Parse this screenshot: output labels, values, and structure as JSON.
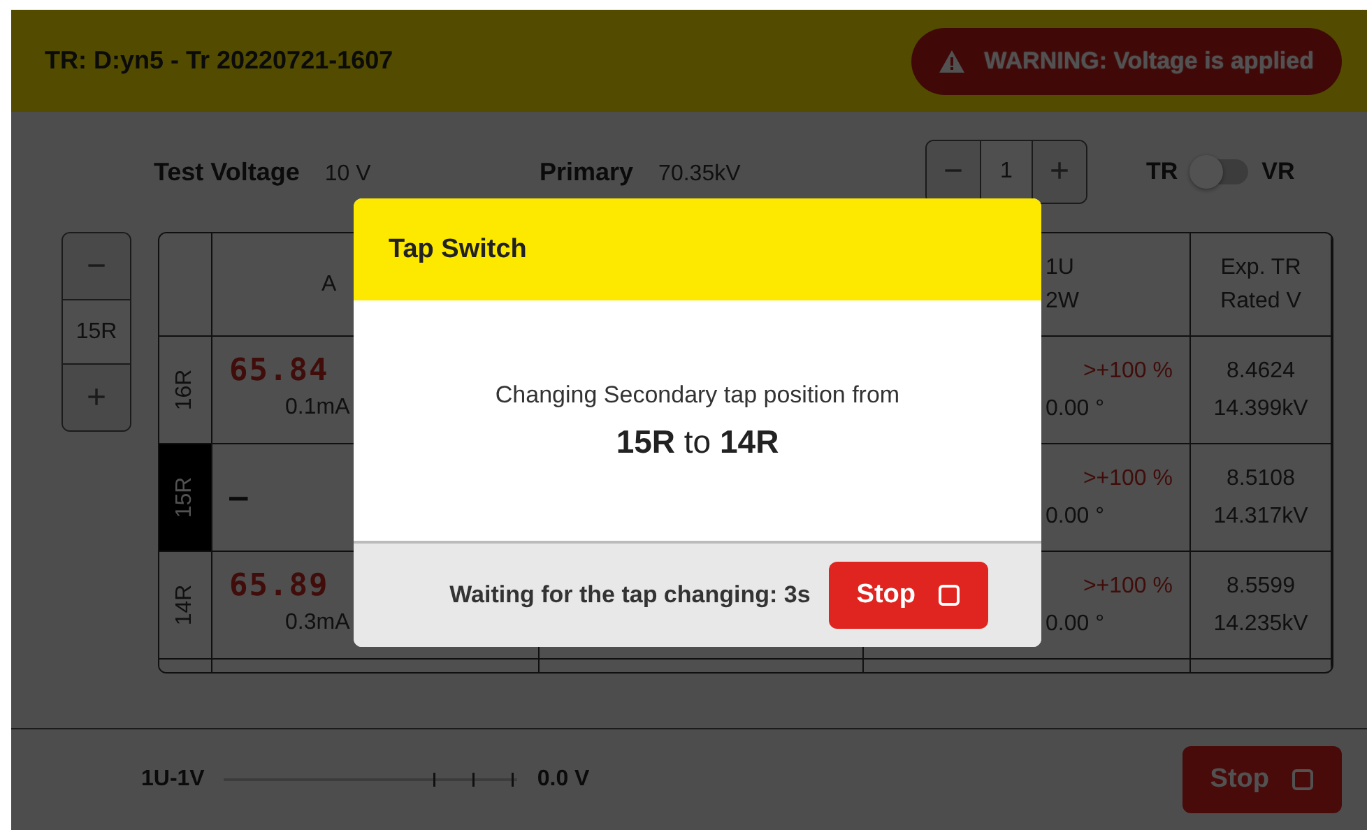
{
  "header": {
    "title": "TR: D:yn5 - Tr 20220721-1607",
    "warning": "WARNING: Voltage is applied"
  },
  "settings": [
    {
      "label": "Test Voltage",
      "value": "10 V"
    },
    {
      "label": "Primary",
      "value": "70.35kV"
    }
  ],
  "phase_stepper": {
    "minus": "−",
    "value": "1",
    "plus": "+"
  },
  "mode_toggle": {
    "left": "TR",
    "right": "VR",
    "on": false
  },
  "tap_stepper": {
    "minus": "−",
    "value": "15R",
    "plus": "+"
  },
  "table": {
    "columns": [
      {
        "top": "A"
      },
      {
        "top": "1U",
        "bottom": "2W"
      },
      {
        "top": "Exp. TR",
        "bottom": "Rated V"
      }
    ],
    "rows": [
      {
        "tap": "16R",
        "selected": false,
        "a_main": "65.84",
        "a_sub": "0.1mA",
        "dev": ">+100 %",
        "phase": "0.00 °",
        "exp": "8.4624",
        "rated": "14.399kV"
      },
      {
        "tap": "15R",
        "selected": true,
        "a_main": "–",
        "a_sub": "",
        "dev": ">+100 %",
        "phase": "0.00 °",
        "exp": "8.5108",
        "rated": "14.317kV"
      },
      {
        "tap": "14R",
        "selected": false,
        "a_main": "65.89",
        "a_sub": "0.3mA",
        "dev": ">+100 %",
        "phase": "0.00 °",
        "exp": "8.5599",
        "rated": "14.235kV"
      }
    ]
  },
  "footer": {
    "channel": "1U-1V",
    "reading": "0.0 V",
    "button": "Stop"
  },
  "dialog": {
    "title": "Tap Switch",
    "message": "Changing Secondary tap position from",
    "change": "**15R** to **14R**",
    "status": "Waiting for the tap changing: 3s",
    "button": "Stop"
  }
}
